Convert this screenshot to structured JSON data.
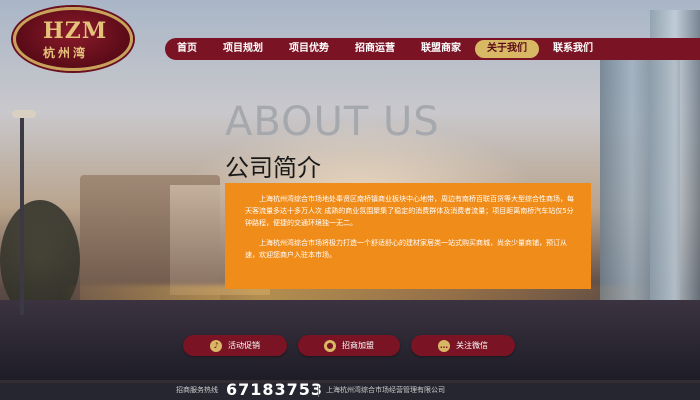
{
  "logo": {
    "mark": "HZM",
    "name": "杭州湾"
  },
  "nav": {
    "items": [
      {
        "label": "首页",
        "active": false
      },
      {
        "label": "项目规划",
        "active": false
      },
      {
        "label": "项目优势",
        "active": false
      },
      {
        "label": "招商运营",
        "active": false
      },
      {
        "label": "联盟商家",
        "active": false
      },
      {
        "label": "关于我们",
        "active": true
      },
      {
        "label": "联系我们",
        "active": false
      }
    ]
  },
  "content": {
    "heading_en": "ABOUT US",
    "heading_cn": "公司简介",
    "paragraphs": [
      "上海杭州湾综合市场地处奉贤区南桥镇商业板块中心地带，周边有南桥百联百货等大型综合性商场，每天客流量多达十多万人次 成熟的商业氛围聚集了稳定的消费群体及消费者流量；项目距离南桥汽车站仅5分钟路程，便捷的交通环境独一无二。",
      "上海杭州湾综合市场将极力打造一个舒适舒心的建材家居类一站式购买商城，尚余少量商铺，预订从速，欢迎您商户入驻本市场。"
    ]
  },
  "buttons": {
    "activity": "活动促销",
    "join": "招商加盟",
    "wechat": "关注微信"
  },
  "footer": {
    "hotline_label": "招商服务热线",
    "hotline_number": "67183753",
    "company": "上海杭州湾综合市场经营管理有限公司"
  },
  "colors": {
    "brand": "#7a1424",
    "accent": "#d8b864",
    "panel": "#f08c1a"
  }
}
